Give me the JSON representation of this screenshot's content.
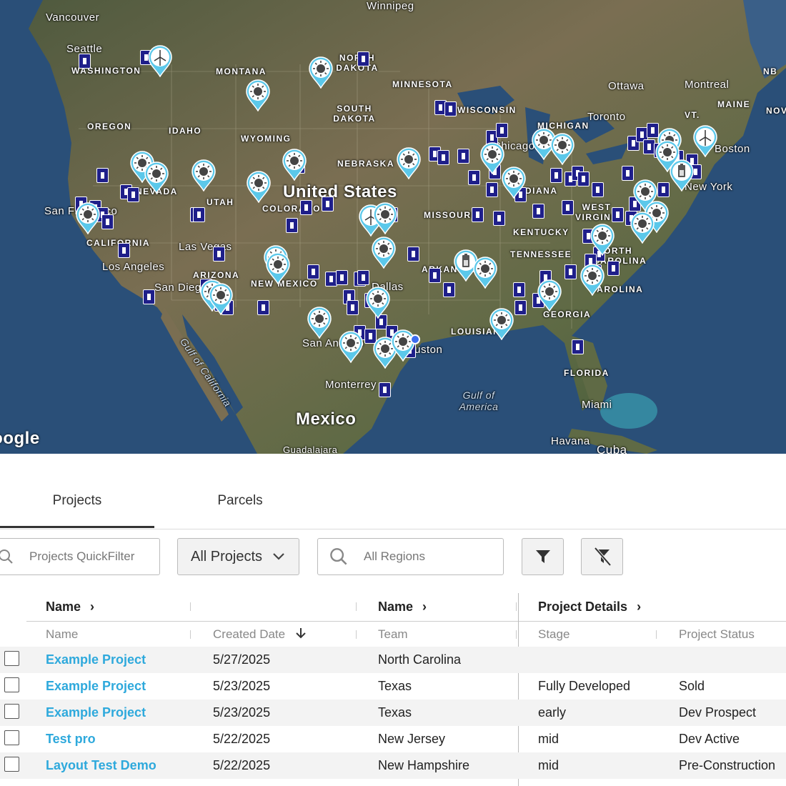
{
  "map": {
    "labels": {
      "vancouver": "Vancouver",
      "winnipeg": "Winnipeg",
      "seattle": "Seattle",
      "washington": "WASHINGTON",
      "montana": "MONTANA",
      "north_dakota": "NORTH DAKOTA",
      "minnesota": "MINNESOTA",
      "ottawa": "Ottawa",
      "montreal": "Montreal",
      "nb": "NB",
      "maine": "MAINE",
      "nov": "NOV",
      "vt": "VT.",
      "toronto": "Toronto",
      "oregon": "OREGON",
      "idaho": "IDAHO",
      "south_dakota": "SOUTH DAKOTA",
      "wisconsin": "WISCONSIN",
      "michigan": "MICHIGAN",
      "wyoming": "WYOMING",
      "boston": "Boston",
      "nebraska": "NEBRASKA",
      "chicago": "Chicago",
      "nevada": "NEVADA",
      "utah": "UTAH",
      "new_york": "New York",
      "united_states": "United States",
      "colorado": "COLORADO",
      "san_francisco": "San Francisco",
      "missouri": "MISSOURI",
      "indiana": "INDIANA",
      "west_virginia": "WEST VIRGINIA",
      "kentucky": "KENTUCKY",
      "california": "CALIFORNIA",
      "las_vegas": "Las Vegas",
      "tennessee": "TENNESSEE",
      "north_carolina": "NORTH CAROLINA",
      "los_angeles": "Los Angeles",
      "arizona": "ARIZONA",
      "arkansas": "ARKANSAS",
      "san_diego": "San Diego",
      "new_mexico": "NEW MEXICO",
      "texas": "Dallas",
      "georgia": "GEORGIA",
      "louisiana": "LOUISIANA",
      "carolina": "CAROLINA",
      "san_antonio": "San Antonio",
      "houston": "Houston",
      "gulf_of_california": "Gulf of California",
      "florida": "FLORIDA",
      "monterrey": "Monterrey",
      "gulf_of_america": "Gulf of America",
      "mexico": "Mexico",
      "miami": "Miami",
      "havana": "Havana",
      "cuba": "Cuba",
      "guadalajara": "Guadalajara",
      "google": "Google"
    },
    "colors": {
      "land": "#6b6a4c",
      "ocean": "#2a4f78",
      "building_marker": "#1f1f8a",
      "pin": "#5bc8ea"
    },
    "marker_types": [
      "building-icon",
      "solar-pin-icon",
      "wind-pin-icon",
      "battery-pin-icon"
    ]
  },
  "tabs": [
    {
      "label": "Projects",
      "active": true
    },
    {
      "label": "Parcels",
      "active": false
    }
  ],
  "toolbar": {
    "quickfilter_placeholder": "Projects QuickFilter",
    "projects_select": "All Projects",
    "regions_placeholder": "All Regions"
  },
  "grid": {
    "group_headers": {
      "name_group_1": "Name",
      "name_group_2": "Name",
      "project_details": "Project Details"
    },
    "columns": [
      "Name",
      "Created Date",
      "Team",
      "Stage",
      "Project Status"
    ],
    "rows": [
      {
        "name": "Example Project",
        "created": "5/27/2025",
        "team": "North Carolina",
        "stage": "",
        "status": ""
      },
      {
        "name": "Example Project",
        "created": "5/23/2025",
        "team": "Texas",
        "stage": "Fully Developed",
        "status": "Sold"
      },
      {
        "name": "Example Project",
        "created": "5/23/2025",
        "team": "Texas",
        "stage": "early",
        "status": "Dev Prospect"
      },
      {
        "name": "Test pro",
        "created": "5/22/2025",
        "team": "New Jersey",
        "stage": "mid",
        "status": "Dev Active"
      },
      {
        "name": "Layout Test Demo",
        "created": "5/22/2025",
        "team": "New Hampshire",
        "stage": "mid",
        "status": "Pre-Construction"
      }
    ]
  }
}
